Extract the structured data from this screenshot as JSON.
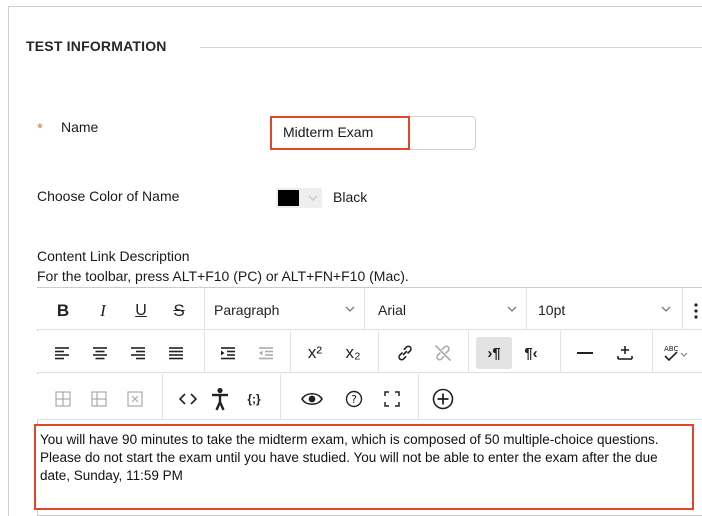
{
  "section": {
    "title": "TEST INFORMATION"
  },
  "name_field": {
    "required_marker": "*",
    "label": "Name",
    "value": "Midterm Exam"
  },
  "color_field": {
    "label": "Choose Color of Name",
    "swatch_color": "#000000",
    "value": "Black"
  },
  "content_link": {
    "label": "Content Link Description",
    "hint": "For the toolbar, press ALT+F10 (PC) or ALT+FN+F10 (Mac)."
  },
  "toolbar": {
    "bold": "B",
    "italic": "I",
    "underline": "U",
    "strikethrough": "S",
    "block_format": "Paragraph",
    "font_family": "Arial",
    "font_size": "10pt",
    "superscript": "x²",
    "subscript": "x₂"
  },
  "editor": {
    "body": "You will have 90 minutes to take the midterm exam, which is composed of 50 multiple-choice questions. Please do not start the exam until you have studied. You will not be able to enter the exam after the due date, Sunday, 11:59 PM"
  },
  "colors": {
    "highlight": "#e2462a",
    "required": "#e07b2c"
  }
}
